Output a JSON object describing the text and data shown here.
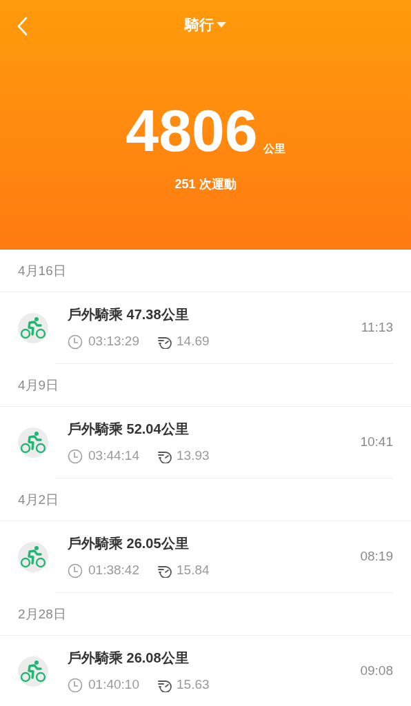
{
  "header": {
    "title": "騎行",
    "total": "4806",
    "unit": "公里",
    "count": "251 次運動"
  },
  "groups": [
    {
      "date": "4月16日",
      "items": [
        {
          "title": "戶外騎乘 47.38公里",
          "duration": "03:13:29",
          "speed": "14.69",
          "time": "11:13"
        }
      ]
    },
    {
      "date": "4月9日",
      "items": [
        {
          "title": "戶外騎乘 52.04公里",
          "duration": "03:44:14",
          "speed": "13.93",
          "time": "10:41"
        }
      ]
    },
    {
      "date": "4月2日",
      "items": [
        {
          "title": "戶外騎乘 26.05公里",
          "duration": "01:38:42",
          "speed": "15.84",
          "time": "08:19"
        }
      ]
    },
    {
      "date": "2月28日",
      "items": [
        {
          "title": "戶外騎乘 26.08公里",
          "duration": "01:40:10",
          "speed": "15.63",
          "time": "09:08"
        }
      ]
    }
  ]
}
